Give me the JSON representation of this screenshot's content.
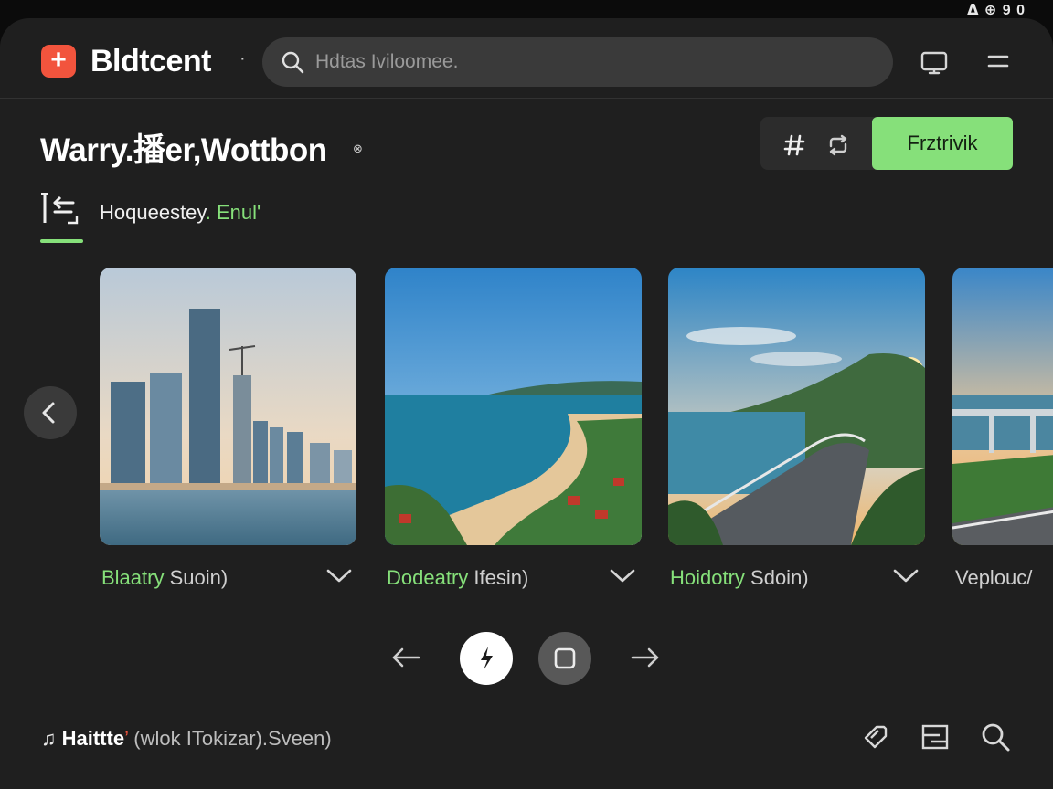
{
  "status_bar": {
    "icons_text": "ᐃ ⊕ 9 0"
  },
  "header": {
    "app_name": "Bldtcent",
    "separator": "·",
    "search": {
      "placeholder": "Hdtas Iviloomee."
    }
  },
  "title_row": {
    "title": "Warry.播er,Wottbon",
    "title_mark": "⊗",
    "toolbar": {
      "primary_label": "Frztrivik"
    }
  },
  "tab": {
    "label_main": "Hoqueestey",
    "label_accent": ". Enul'"
  },
  "cards": [
    {
      "title_accent": "Blaatry",
      "title_rest": " Suoin)"
    },
    {
      "title_accent": "Dodeatry",
      "title_rest": " Ifesin)"
    },
    {
      "title_accent": "Hoidotry",
      "title_rest": " Sdoin)"
    },
    {
      "title_accent": "",
      "title_rest": "Veplouc/"
    }
  ],
  "footer": {
    "note_main": "Haittte",
    "note_mark": "’",
    "note_rest": " (wlok ITokizar).Sveen)"
  },
  "colors": {
    "accent": "#86e07a",
    "brand": "#f2543d",
    "panel": "#1f1f1f",
    "search_bg": "#3a3a3a"
  }
}
